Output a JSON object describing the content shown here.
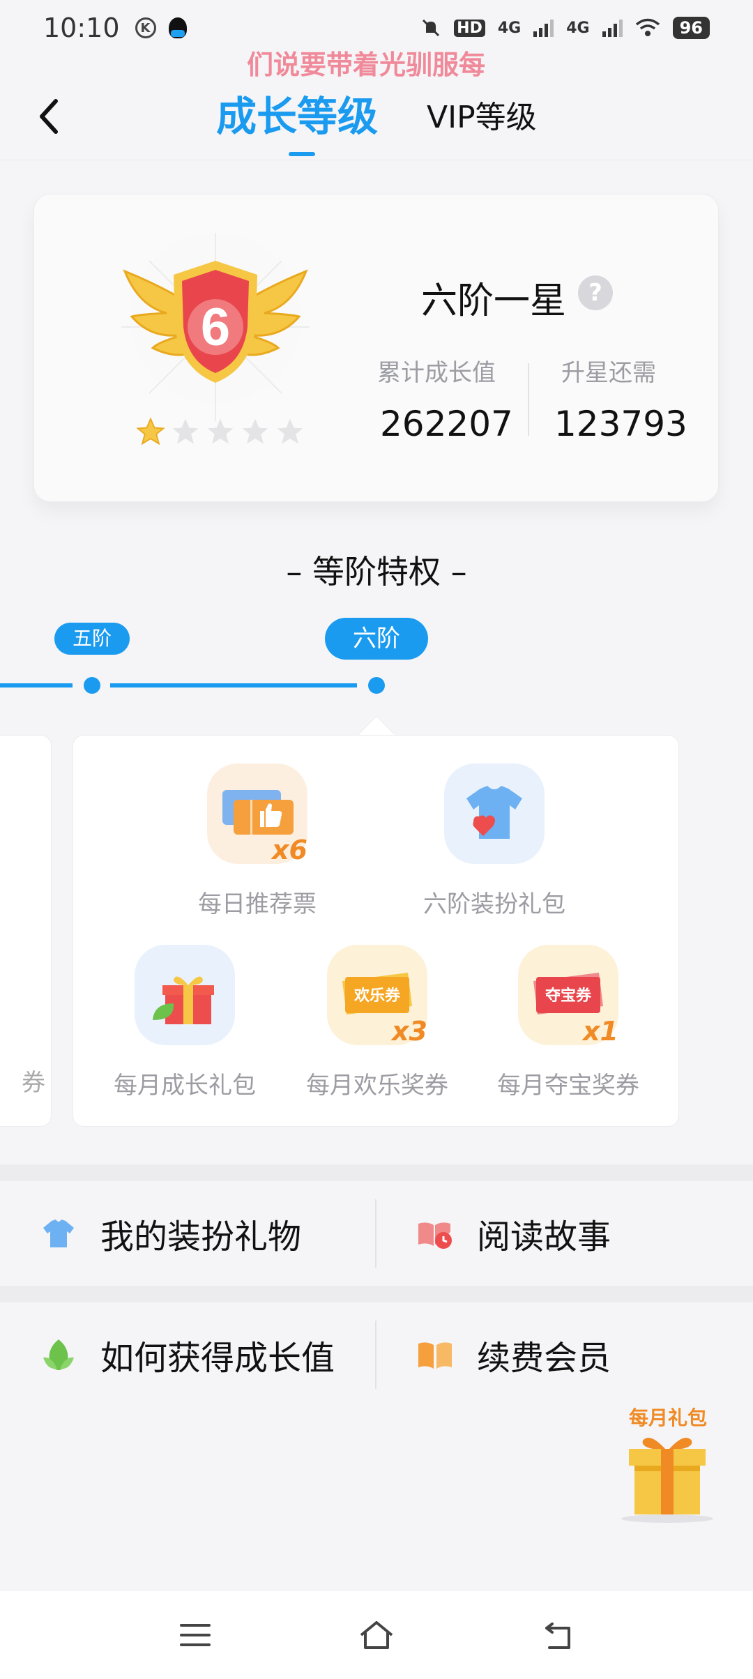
{
  "status_bar": {
    "time": "10:10",
    "k_label": "K",
    "signal_1": "4G",
    "signal_2": "4G",
    "hd_label": "HD",
    "battery": "96"
  },
  "marquee_text": "们说要带着光驯服每",
  "nav": {
    "tab_growth": "成长等级",
    "tab_vip": "VIP等级"
  },
  "level_card": {
    "badge_number": "6",
    "level_name": "六阶一星",
    "help_symbol": "?",
    "total_label": "累计成长值",
    "total_value": "262207",
    "need_label": "升星还需",
    "need_value": "123793",
    "stars_filled": 1,
    "stars_total": 5
  },
  "section_title": "– 等阶特权 –",
  "tiers": {
    "prev": "五阶",
    "current": "六阶"
  },
  "prev_card_text": "券",
  "benefits": [
    {
      "label": "每日推荐票",
      "multiplier": "x6",
      "icon": "ticket-thumbs-up-icon"
    },
    {
      "label": "六阶装扮礼包",
      "multiplier": "",
      "icon": "tshirt-heart-icon"
    },
    {
      "label": "每月成长礼包",
      "multiplier": "",
      "icon": "gift-box-leaf-icon"
    },
    {
      "label": "每月欢乐奖券",
      "multiplier": "x3",
      "icon": "happy-coupon-icon",
      "coupon_text": "欢乐券"
    },
    {
      "label": "每月夺宝奖券",
      "multiplier": "x1",
      "icon": "treasure-coupon-icon",
      "coupon_text": "夺宝券"
    }
  ],
  "menu": {
    "row1": [
      {
        "label": "我的装扮礼物",
        "icon": "tshirt-icon"
      },
      {
        "label": "阅读故事",
        "icon": "book-clock-icon"
      }
    ],
    "row2": [
      {
        "label": "如何获得成长值",
        "icon": "leaf-icon"
      },
      {
        "label": "续费会员",
        "icon": "open-book-icon"
      }
    ]
  },
  "monthly_gift_label": "每月礼包",
  "colors": {
    "accent": "#1a9bf0",
    "orange": "#f08a24",
    "shield_red": "#e8464c",
    "gold": "#f6c744"
  }
}
